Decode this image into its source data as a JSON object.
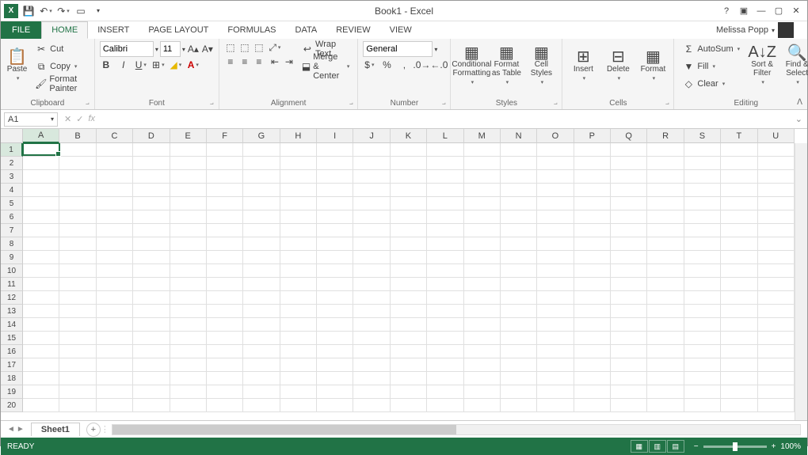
{
  "title": "Book1 - Excel",
  "user": "Melissa Popp",
  "tabs": {
    "file": "FILE",
    "list": [
      "HOME",
      "INSERT",
      "PAGE LAYOUT",
      "FORMULAS",
      "DATA",
      "REVIEW",
      "VIEW"
    ],
    "active": "HOME"
  },
  "clipboard": {
    "paste": "Paste",
    "cut": "Cut",
    "copy": "Copy",
    "painter": "Format Painter",
    "label": "Clipboard"
  },
  "font": {
    "name": "Calibri",
    "size": "11",
    "label": "Font"
  },
  "alignment": {
    "wrap": "Wrap Text",
    "merge": "Merge & Center",
    "label": "Alignment"
  },
  "number": {
    "format": "General",
    "label": "Number"
  },
  "styles": {
    "cond": "Conditional Formatting",
    "table": "Format as Table",
    "cell": "Cell Styles",
    "label": "Styles"
  },
  "cells": {
    "insert": "Insert",
    "delete": "Delete",
    "format": "Format",
    "label": "Cells"
  },
  "editing": {
    "sum": "AutoSum",
    "fill": "Fill",
    "clear": "Clear",
    "sort": "Sort & Filter",
    "find": "Find & Select",
    "label": "Editing"
  },
  "namebox": "A1",
  "columns": [
    "A",
    "B",
    "C",
    "D",
    "E",
    "F",
    "G",
    "H",
    "I",
    "J",
    "K",
    "L",
    "M",
    "N",
    "O",
    "P",
    "Q",
    "R",
    "S",
    "T",
    "U"
  ],
  "rows": [
    "1",
    "2",
    "3",
    "4",
    "5",
    "6",
    "7",
    "8",
    "9",
    "10",
    "11",
    "12",
    "13",
    "14",
    "15",
    "16",
    "17",
    "18",
    "19",
    "20"
  ],
  "active_col": "A",
  "active_row": "1",
  "sheet": "Sheet1",
  "status": "READY",
  "zoom": "100%"
}
